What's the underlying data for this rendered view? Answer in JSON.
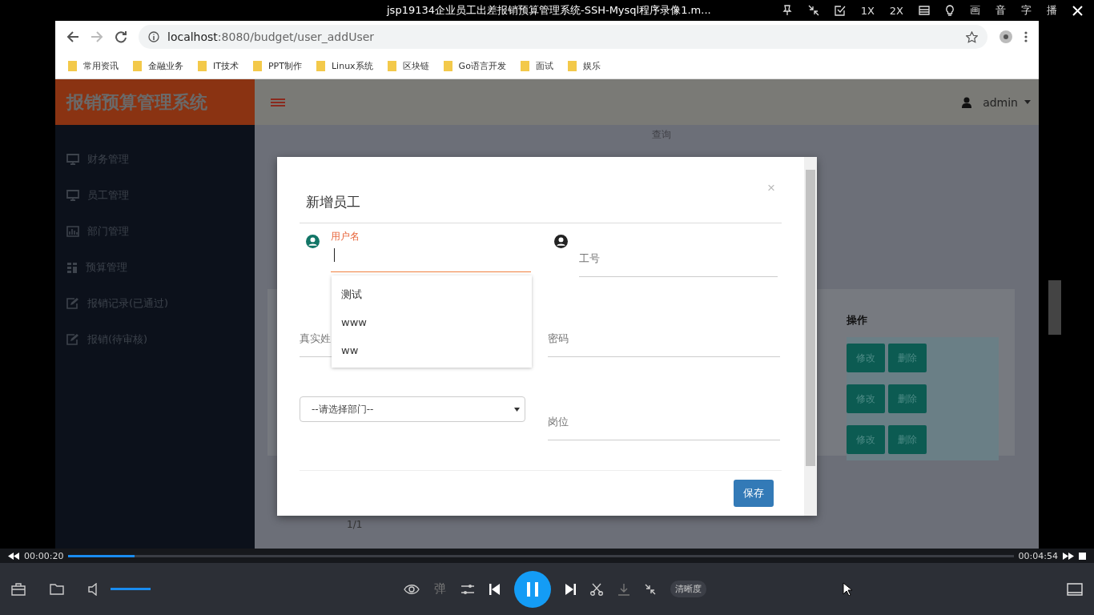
{
  "player": {
    "title": "jsp19134企业员工出差报销预算管理系统-SSH-Mysql程序录像1.m...",
    "top_controls": [
      {
        "kind": "pin"
      },
      {
        "kind": "shrink"
      },
      {
        "kind": "check"
      },
      {
        "kind": "text",
        "label": "1X"
      },
      {
        "kind": "text",
        "label": "2X"
      },
      {
        "kind": "list"
      },
      {
        "kind": "bulb"
      },
      {
        "kind": "text",
        "label": "画"
      },
      {
        "kind": "text",
        "label": "音"
      },
      {
        "kind": "text",
        "label": "字"
      },
      {
        "kind": "text",
        "label": "播"
      },
      {
        "kind": "close"
      }
    ],
    "elapsed": "00:00:20",
    "total": "00:04:54",
    "progress": {
      "level": 0.07
    },
    "volume": {
      "level": 1
    },
    "danmaku": "弹",
    "quality": "清晰度"
  },
  "browser": {
    "url_host": "localhost",
    "url_rest": ":8080/budget/user_addUser",
    "bookmarks": [
      "常用资讯",
      "金融业务",
      "IT技术",
      "PPT制作",
      "Linux系统",
      "区块链",
      "Go语言开发",
      "面试",
      "娱乐"
    ]
  },
  "app": {
    "brand": "报销预算管理系统",
    "user": "admin",
    "sidebar": [
      {
        "kind": "monitor",
        "label": "财务管理"
      },
      {
        "kind": "monitor",
        "label": "员工管理"
      },
      {
        "kind": "chart",
        "label": "部门管理"
      },
      {
        "kind": "grid",
        "label": "预算管理"
      },
      {
        "kind": "edit",
        "label": "报销记录(已通过)"
      },
      {
        "kind": "edit",
        "label": "报销(待审核)"
      }
    ],
    "background": {
      "search_label": "查询",
      "column": "操作",
      "rows": [
        [
          "修改",
          "删除"
        ],
        [
          "修改",
          "删除"
        ],
        [
          "修改",
          "删除"
        ]
      ],
      "pager": "1/1"
    }
  },
  "modal": {
    "title": "新增员工",
    "close": "×",
    "username": {
      "label": "用户名",
      "focused": true,
      "suggestions": [
        "测试",
        "www",
        "ww"
      ]
    },
    "employee_no": {
      "placeholder": "工号"
    },
    "real_name": {
      "placeholder": "真实姓"
    },
    "password": {
      "placeholder": "密码"
    },
    "department": {
      "value": "--请选择部门--"
    },
    "position": {
      "placeholder": "岗位"
    },
    "save": "保存"
  }
}
